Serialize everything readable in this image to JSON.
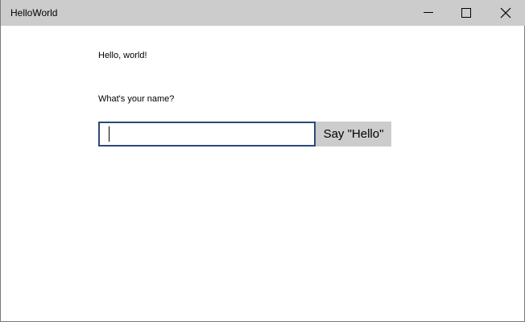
{
  "window": {
    "title": "HelloWorld"
  },
  "content": {
    "greeting": "Hello, world!",
    "name_prompt": "What's your name?",
    "name_input_value": "",
    "say_hello_label": "Say \"Hello\""
  },
  "icons": {
    "minimize": "minimize-icon",
    "maximize": "maximize-icon",
    "close": "close-icon"
  },
  "colors": {
    "titlebar_bg": "#cccccc",
    "input_border": "#2b4a78",
    "button_bg": "#cccccc"
  }
}
